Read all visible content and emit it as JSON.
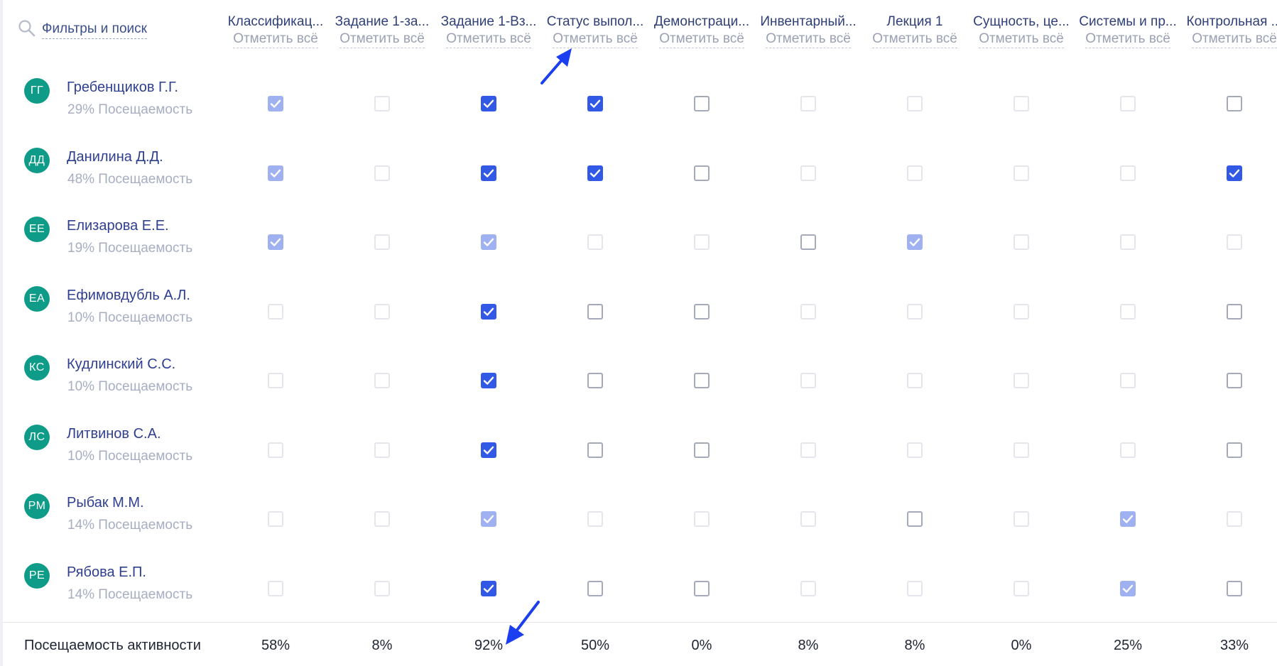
{
  "header": {
    "search_label": "Фильтры и поиск",
    "search_icon": "search-icon",
    "columns": [
      {
        "title": "Классификац...",
        "mark_all": "Отметить всё"
      },
      {
        "title": "Задание 1-за...",
        "mark_all": "Отметить всё"
      },
      {
        "title": "Задание 1-Вз...",
        "mark_all": "Отметить всё"
      },
      {
        "title": "Статус выпол...",
        "mark_all": "Отметить всё"
      },
      {
        "title": "Демонстраци...",
        "mark_all": "Отметить всё"
      },
      {
        "title": "Инвентарный...",
        "mark_all": "Отметить всё"
      },
      {
        "title": "Лекция 1",
        "mark_all": "Отметить всё"
      },
      {
        "title": "Сущность, це...",
        "mark_all": "Отметить всё"
      },
      {
        "title": "Системы и пр...",
        "mark_all": "Отметить всё"
      },
      {
        "title": "Контрольная ...",
        "mark_all": "Отметить всё"
      }
    ]
  },
  "students": [
    {
      "initials": "ГГ",
      "name": "Гребенщиков Г.Г.",
      "attendance": "29% Посещаемость",
      "cells": [
        "checked-light",
        "unchecked-light",
        "checked",
        "checked",
        "unchecked",
        "unchecked-light",
        "unchecked-light",
        "unchecked-light",
        "unchecked-light",
        "unchecked"
      ]
    },
    {
      "initials": "ДД",
      "name": "Данилина Д.Д.",
      "attendance": "48% Посещаемость",
      "cells": [
        "checked-light",
        "unchecked-light",
        "checked",
        "checked",
        "unchecked",
        "unchecked-light",
        "unchecked-light",
        "unchecked-light",
        "unchecked-light",
        "checked"
      ]
    },
    {
      "initials": "ЕЕ",
      "name": "Елизарова Е.Е.",
      "attendance": "19% Посещаемость",
      "cells": [
        "checked-light",
        "unchecked-light",
        "checked-light",
        "unchecked-light",
        "unchecked-light",
        "unchecked",
        "checked-light",
        "unchecked-light",
        "unchecked-light",
        "unchecked-light"
      ]
    },
    {
      "initials": "ЕА",
      "name": "Ефимовдубль А.Л.",
      "attendance": "10% Посещаемость",
      "cells": [
        "unchecked-light",
        "unchecked-light",
        "checked",
        "unchecked",
        "unchecked",
        "unchecked-light",
        "unchecked-light",
        "unchecked-light",
        "unchecked-light",
        "unchecked"
      ]
    },
    {
      "initials": "КС",
      "name": "Кудлинский С.С.",
      "attendance": "10% Посещаемость",
      "cells": [
        "unchecked-light",
        "unchecked-light",
        "checked",
        "unchecked",
        "unchecked",
        "unchecked-light",
        "unchecked-light",
        "unchecked-light",
        "unchecked-light",
        "unchecked"
      ]
    },
    {
      "initials": "ЛС",
      "name": "Литвинов С.А.",
      "attendance": "10% Посещаемость",
      "cells": [
        "unchecked-light",
        "unchecked-light",
        "checked",
        "unchecked",
        "unchecked",
        "unchecked-light",
        "unchecked-light",
        "unchecked-light",
        "unchecked-light",
        "unchecked"
      ]
    },
    {
      "initials": "РМ",
      "name": "Рыбак М.М.",
      "attendance": "14% Посещаемость",
      "cells": [
        "unchecked-light",
        "unchecked-light",
        "checked-light",
        "unchecked-light",
        "unchecked-light",
        "unchecked-light",
        "unchecked",
        "unchecked-light",
        "checked-light",
        "unchecked-light"
      ]
    },
    {
      "initials": "РЕ",
      "name": "Рябова Е.П.",
      "attendance": "14% Посещаемость",
      "cells": [
        "unchecked-light",
        "unchecked-light",
        "checked",
        "unchecked",
        "unchecked",
        "unchecked-light",
        "unchecked-light",
        "unchecked-light",
        "checked-light",
        "unchecked"
      ]
    }
  ],
  "footer": {
    "label": "Посещаемость активности",
    "percents": [
      "58%",
      "8%",
      "92%",
      "50%",
      "0%",
      "8%",
      "8%",
      "0%",
      "25%",
      "33%"
    ]
  },
  "colors": {
    "accent": "#3159e6",
    "accent_light": "#9fb1f1",
    "avatar": "#0e9b88",
    "annotation_arrow": "#1a3ef0"
  }
}
